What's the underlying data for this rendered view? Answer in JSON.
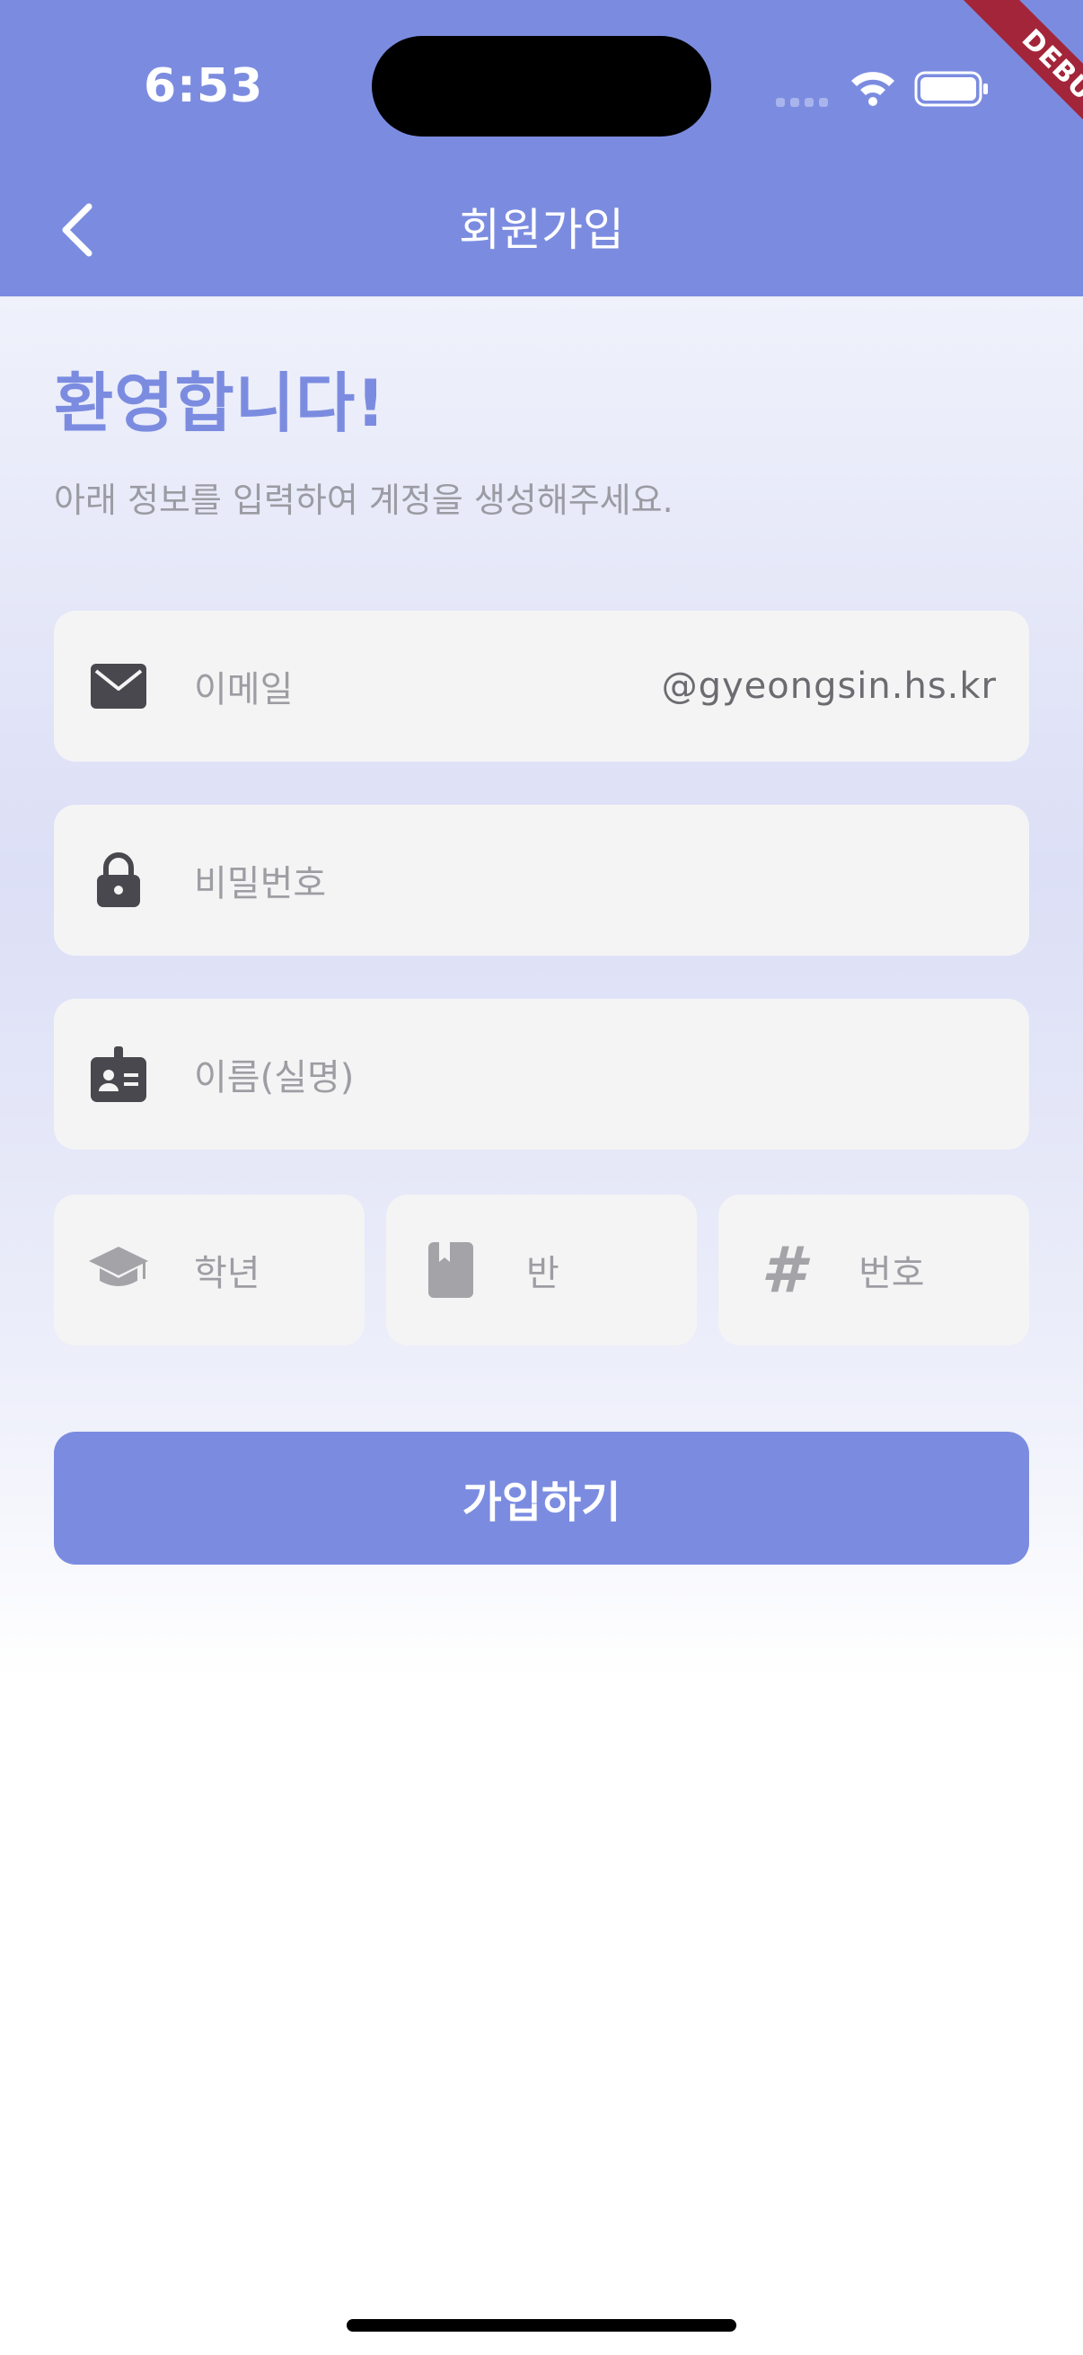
{
  "status_bar": {
    "time": "6:53"
  },
  "debug_banner": "DEBUG",
  "header": {
    "title": "회원가입",
    "back_icon": "chevron-left-icon"
  },
  "intro": {
    "welcome": "환영합니다!",
    "subtitle": "아래 정보를 입력하여 계정을 생성해주세요."
  },
  "form": {
    "email": {
      "placeholder": "이메일",
      "suffix": "@gyeongsin.hs.kr",
      "icon": "mail-icon"
    },
    "password": {
      "placeholder": "비밀번호",
      "icon": "lock-icon"
    },
    "name": {
      "placeholder": "이름(실명)",
      "icon": "id-badge-icon"
    },
    "grade": {
      "placeholder": "학년",
      "icon": "graduation-cap-icon"
    },
    "class": {
      "placeholder": "반",
      "icon": "book-icon"
    },
    "number": {
      "placeholder": "번호",
      "icon": "hash-icon",
      "glyph": "#"
    },
    "submit_label": "가입하기"
  },
  "colors": {
    "primary": "#7b8ce0",
    "field_bg": "#f4f4f5",
    "placeholder": "#9d9da3",
    "debug": "#a3253a"
  }
}
